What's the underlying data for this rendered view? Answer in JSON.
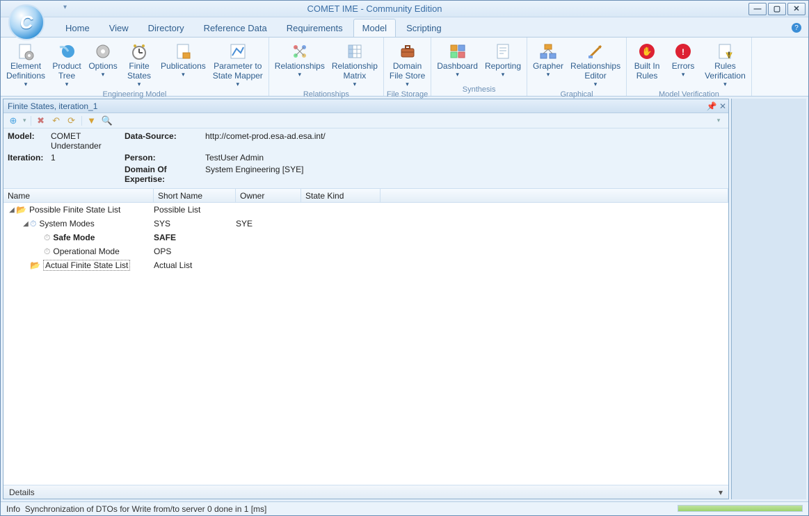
{
  "window": {
    "title": "COMET IME - Community Edition"
  },
  "menu": {
    "items": [
      "Home",
      "View",
      "Directory",
      "Reference Data",
      "Requirements",
      "Model",
      "Scripting"
    ],
    "active": 5
  },
  "ribbon": {
    "groups": [
      {
        "label": "Engineering Model",
        "buttons": [
          {
            "id": "element-definitions",
            "label": "Element\nDefinitions",
            "dd": true,
            "icon": "gear-sheet"
          },
          {
            "id": "product-tree",
            "label": "Product\nTree",
            "dd": true,
            "icon": "comet"
          },
          {
            "id": "options",
            "label": "Options",
            "dd": true,
            "icon": "options-gear"
          },
          {
            "id": "finite-states",
            "label": "Finite\nStates",
            "dd": true,
            "icon": "clock"
          },
          {
            "id": "publications",
            "label": "Publications",
            "dd": true,
            "icon": "publication"
          },
          {
            "id": "parameter-to-state-mapper",
            "label": "Parameter to\nState Mapper",
            "dd": true,
            "icon": "mapper"
          }
        ]
      },
      {
        "label": "Relationships",
        "buttons": [
          {
            "id": "relationships",
            "label": "Relationships",
            "dd": true,
            "icon": "relations"
          },
          {
            "id": "relationship-matrix",
            "label": "Relationship\nMatrix",
            "dd": true,
            "icon": "matrix"
          }
        ]
      },
      {
        "label": "File Storage",
        "buttons": [
          {
            "id": "domain-file-store",
            "label": "Domain\nFile Store",
            "dd": true,
            "icon": "briefcase"
          }
        ]
      },
      {
        "label": "Synthesis",
        "buttons": [
          {
            "id": "dashboard",
            "label": "Dashboard",
            "dd": true,
            "icon": "dashboard"
          },
          {
            "id": "reporting",
            "label": "Reporting",
            "dd": true,
            "icon": "report"
          }
        ]
      },
      {
        "label": "Graphical",
        "buttons": [
          {
            "id": "grapher",
            "label": "Grapher",
            "dd": true,
            "icon": "grapher"
          },
          {
            "id": "relationships-editor",
            "label": "Relationships\nEditor",
            "dd": true,
            "icon": "rel-editor"
          }
        ]
      },
      {
        "label": "Model Verification",
        "buttons": [
          {
            "id": "built-in-rules",
            "label": "Built In\nRules",
            "dd": false,
            "icon": "hand-stop"
          },
          {
            "id": "errors",
            "label": "Errors",
            "dd": true,
            "icon": "error"
          },
          {
            "id": "rules-verification",
            "label": "Rules\nVerification",
            "dd": true,
            "icon": "rules-doc"
          }
        ]
      }
    ]
  },
  "panel": {
    "title": "Finite States, iteration_1",
    "meta": {
      "model_label": "Model:",
      "model": "COMET Understander",
      "datasource_label": "Data-Source:",
      "datasource": "http://comet-prod.esa-ad.esa.int/",
      "iteration_label": "Iteration:",
      "iteration": "1",
      "person_label": "Person:",
      "person": "TestUser Admin",
      "domain_label": "Domain Of Expertise:",
      "domain": "System Engineering [SYE]"
    },
    "columns": {
      "name": "Name",
      "short": "Short Name",
      "owner": "Owner",
      "kind": "State Kind"
    },
    "rows": [
      {
        "depth": 0,
        "expander": "▢",
        "icon": "folder",
        "name": "Possible Finite State List",
        "short": "Possible List",
        "owner": "",
        "kind": "",
        "bold": false
      },
      {
        "depth": 1,
        "expander": "▢",
        "icon": "state",
        "name": "System Modes",
        "short": "SYS",
        "owner": "SYE",
        "kind": "",
        "bold": false
      },
      {
        "depth": 2,
        "expander": "",
        "icon": "mode",
        "name": "Safe Mode",
        "short": "SAFE",
        "owner": "",
        "kind": "",
        "bold": true
      },
      {
        "depth": 2,
        "expander": "",
        "icon": "mode",
        "name": "Operational Mode",
        "short": "OPS",
        "owner": "",
        "kind": "",
        "bold": false
      },
      {
        "depth": 1,
        "expander": "",
        "icon": "folder",
        "name": "Actual Finite State List",
        "short": "Actual List",
        "owner": "",
        "kind": "",
        "bold": false,
        "dotted": true
      }
    ],
    "details_label": "Details"
  },
  "status": {
    "prefix": "Info",
    "message": "Synchronization of DTOs for Write from/to server 0 done in 1 [ms]"
  }
}
